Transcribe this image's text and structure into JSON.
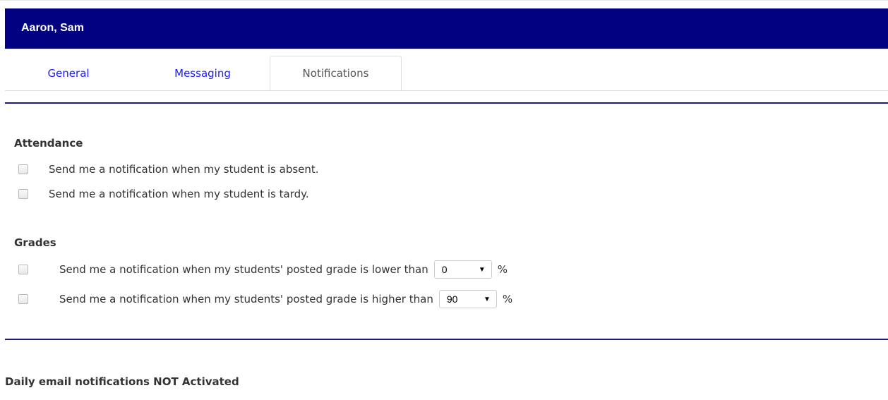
{
  "header": {
    "title": "Aaron, Sam"
  },
  "tabs": [
    {
      "label": "General",
      "active": false
    },
    {
      "label": "Messaging",
      "active": false
    },
    {
      "label": "Notifications",
      "active": true
    }
  ],
  "attendance": {
    "title": "Attendance",
    "options": [
      {
        "label": "Send me a notification when my student is absent.",
        "checked": false
      },
      {
        "label": "Send me a notification when my student is tardy.",
        "checked": false
      }
    ]
  },
  "grades": {
    "title": "Grades",
    "lower": {
      "label": "Send me a notification when my students' posted grade is lower than",
      "value": "0",
      "suffix": "%",
      "checked": false
    },
    "higher": {
      "label": "Send me a notification when my students' posted grade is higher than",
      "value": "90",
      "suffix": "%",
      "checked": false
    }
  },
  "footer": {
    "status": "Daily email notifications NOT Activated"
  },
  "colors": {
    "header_bg": "#000080",
    "link": "#1a1aff",
    "rule": "#1a1a80"
  },
  "icons": {
    "dropdown": "chevron-down-icon"
  }
}
